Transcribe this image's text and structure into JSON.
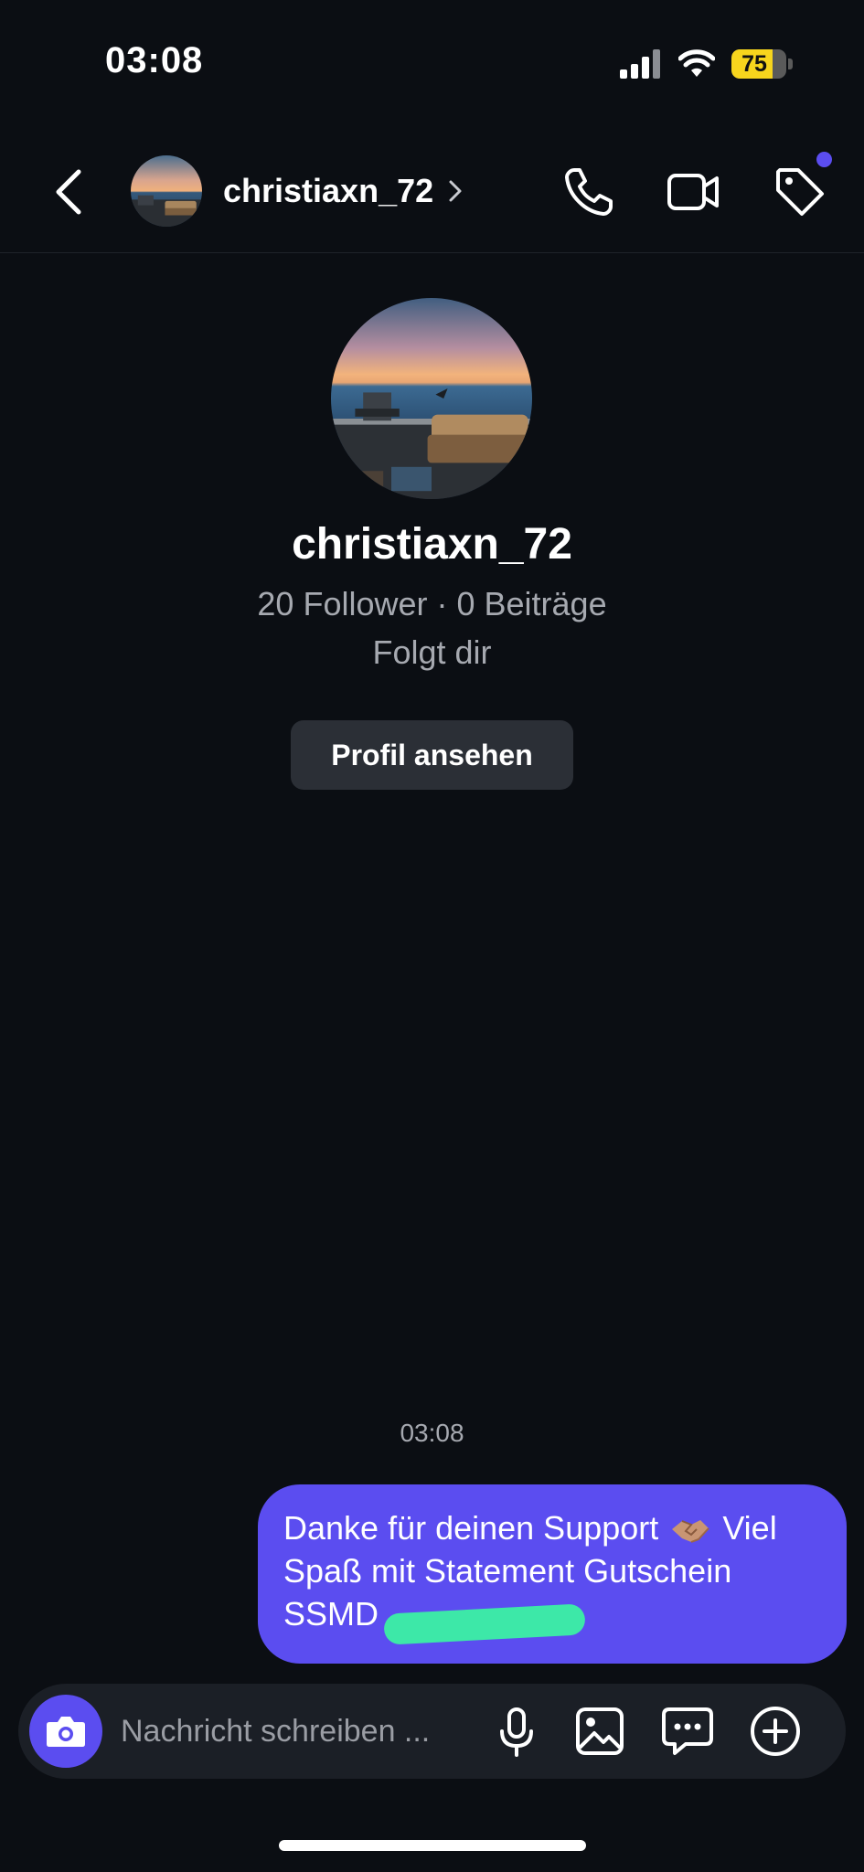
{
  "status_bar": {
    "time": "03:08",
    "battery_level": 75,
    "battery_text": "75"
  },
  "header": {
    "username": "christiaxn_72",
    "icons": [
      "back-icon",
      "chevron-right-icon",
      "phone-icon",
      "video-icon",
      "tag-icon"
    ],
    "notification_dot": true
  },
  "profile": {
    "username": "christiaxn_72",
    "stats": "20 Follower · 0 Beiträge",
    "follow_status": "Folgt dir",
    "view_profile_label": "Profil ansehen"
  },
  "conversation": {
    "timestamp": "03:08",
    "message": {
      "text_before_emoji": "Danke für deinen Support",
      "emoji": "handshake-emoji",
      "text_after_emoji": "Viel Spaß mit Statement Gutschein SSMD",
      "redacted": true,
      "outgoing": true
    }
  },
  "composer": {
    "placeholder": "Nachricht schreiben ...",
    "value": "",
    "icons": [
      "camera-icon",
      "microphone-icon",
      "gallery-icon",
      "chat-bubble-icon",
      "plus-icon"
    ]
  },
  "colors": {
    "background": "#0b0e13",
    "accent": "#5b4df0",
    "secondary_text": "#a6a9b0",
    "battery": "#f7d51d",
    "redaction": "#3de8a8"
  }
}
